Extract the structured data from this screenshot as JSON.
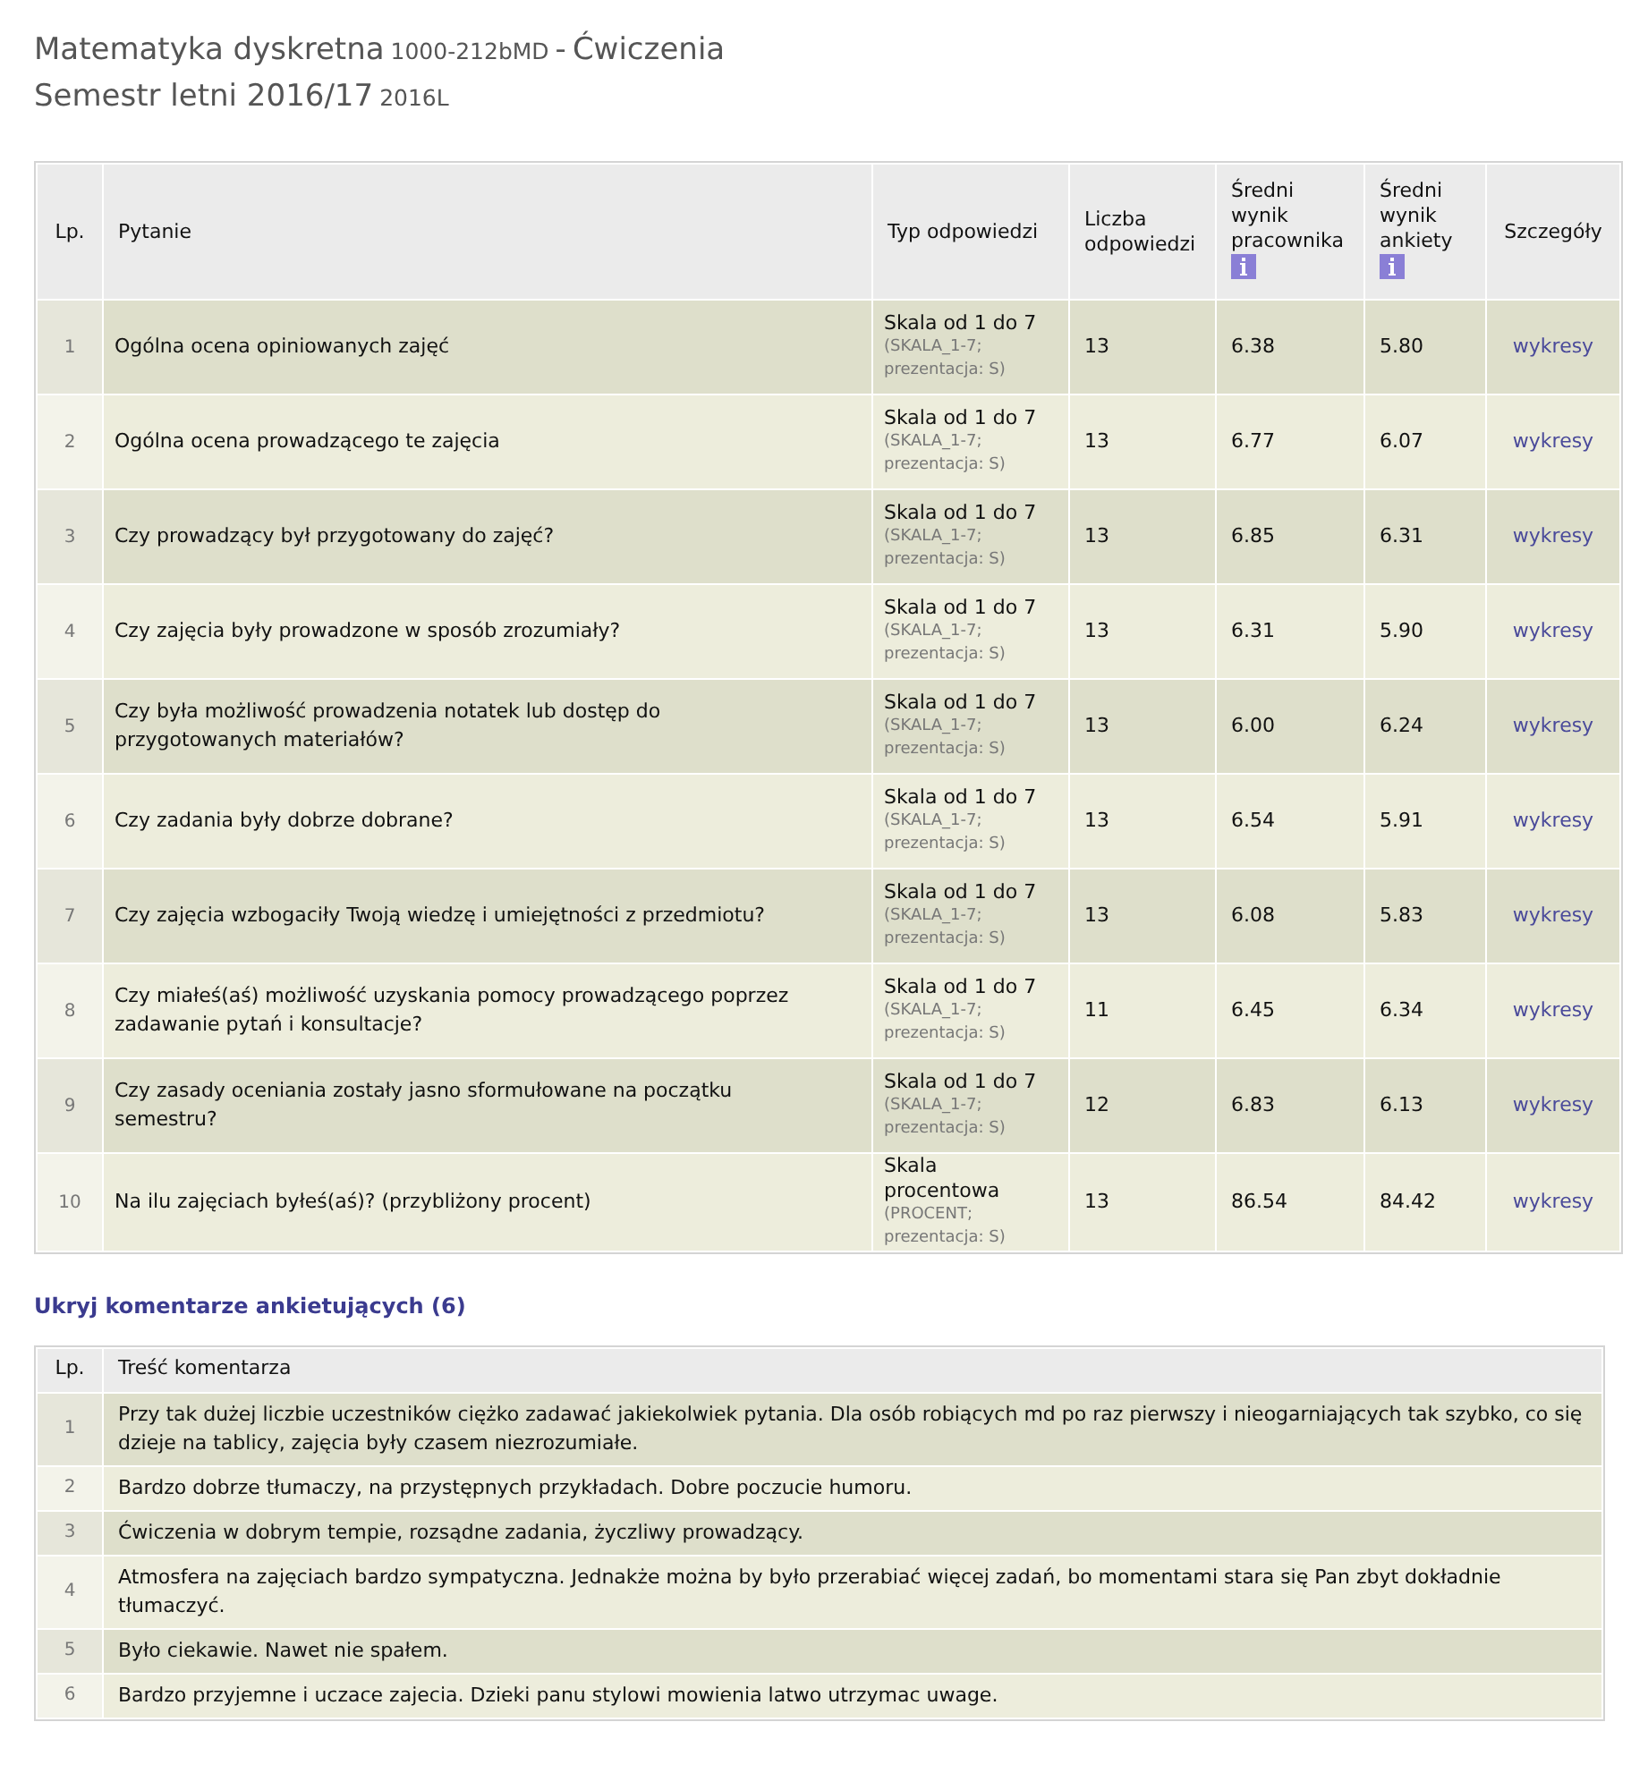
{
  "heading": {
    "course": "Matematyka dyskretna",
    "code": "1000-212bMD",
    "separator": "-",
    "type": "Ćwiczenia",
    "semester": "Semestr letni 2016/17",
    "semester_code": "2016L"
  },
  "questions_table": {
    "columns": [
      {
        "label": "Lp.",
        "info": false
      },
      {
        "label": "Pytanie",
        "info": false
      },
      {
        "label": "Typ odpowiedzi",
        "info": false
      },
      {
        "label": "Liczba odpowiedzi",
        "info": false
      },
      {
        "label": "Średni wynik pracownika",
        "info": true
      },
      {
        "label": "Średni wynik ankiety",
        "info": true
      },
      {
        "label": "Szczegóły",
        "info": false
      }
    ],
    "rows": [
      {
        "lp": "1",
        "question": "Ogólna ocena opiniowanych zajęć",
        "type": "Skala od 1 do 7",
        "type_code": "(SKALA_1-7; prezentacja: S)",
        "count": "13",
        "employee_avg": "6.38",
        "survey_avg": "5.80",
        "link": "wykresy"
      },
      {
        "lp": "2",
        "question": "Ogólna ocena prowadzącego te zajęcia",
        "type": "Skala od 1 do 7",
        "type_code": "(SKALA_1-7; prezentacja: S)",
        "count": "13",
        "employee_avg": "6.77",
        "survey_avg": "6.07",
        "link": "wykresy"
      },
      {
        "lp": "3",
        "question": "Czy prowadzący był przygotowany do zajęć?",
        "type": "Skala od 1 do 7",
        "type_code": "(SKALA_1-7; prezentacja: S)",
        "count": "13",
        "employee_avg": "6.85",
        "survey_avg": "6.31",
        "link": "wykresy"
      },
      {
        "lp": "4",
        "question": "Czy zajęcia były prowadzone w sposób zrozumiały?",
        "type": "Skala od 1 do 7",
        "type_code": "(SKALA_1-7; prezentacja: S)",
        "count": "13",
        "employee_avg": "6.31",
        "survey_avg": "5.90",
        "link": "wykresy"
      },
      {
        "lp": "5",
        "question": "Czy była możliwość prowadzenia notatek lub dostęp do przygotowanych materiałów?",
        "type": "Skala od 1 do 7",
        "type_code": "(SKALA_1-7; prezentacja: S)",
        "count": "13",
        "employee_avg": "6.00",
        "survey_avg": "6.24",
        "link": "wykresy"
      },
      {
        "lp": "6",
        "question": "Czy zadania były dobrze dobrane?",
        "type": "Skala od 1 do 7",
        "type_code": "(SKALA_1-7; prezentacja: S)",
        "count": "13",
        "employee_avg": "6.54",
        "survey_avg": "5.91",
        "link": "wykresy"
      },
      {
        "lp": "7",
        "question": "Czy zajęcia wzbogaciły Twoją wiedzę i umiejętności z przedmiotu?",
        "type": "Skala od 1 do 7",
        "type_code": "(SKALA_1-7; prezentacja: S)",
        "count": "13",
        "employee_avg": "6.08",
        "survey_avg": "5.83",
        "link": "wykresy"
      },
      {
        "lp": "8",
        "question": "Czy miałeś(aś) możliwość uzyskania pomocy prowadzącego poprzez zadawanie pytań i konsultacje?",
        "type": "Skala od 1 do 7",
        "type_code": "(SKALA_1-7; prezentacja: S)",
        "count": "11",
        "employee_avg": "6.45",
        "survey_avg": "6.34",
        "link": "wykresy"
      },
      {
        "lp": "9",
        "question": "Czy zasady oceniania zostały jasno sformułowane na początku semestru?",
        "type": "Skala od 1 do 7",
        "type_code": "(SKALA_1-7; prezentacja: S)",
        "count": "12",
        "employee_avg": "6.83",
        "survey_avg": "6.13",
        "link": "wykresy"
      },
      {
        "lp": "10",
        "question": "Na ilu zajęciach byłeś(aś)? (przybliżony procent)",
        "type": "Skala procentowa",
        "type_code": "(PROCENT; prezentacja: S)",
        "count": "13",
        "employee_avg": "86.54",
        "survey_avg": "84.42",
        "link": "wykresy"
      }
    ]
  },
  "comments_toggle": "Ukryj komentarze ankietujących (6)",
  "comments_table": {
    "columns": [
      "Lp.",
      "Treść komentarza"
    ],
    "rows": [
      {
        "lp": "1",
        "text": "Przy tak dużej liczbie uczestników ciężko zadawać jakiekolwiek pytania. Dla osób robiących md po raz pierwszy i nieogarniających tak szybko, co się dzieje na tablicy, zajęcia były czasem niezrozumiałe."
      },
      {
        "lp": "2",
        "text": "Bardzo dobrze tłumaczy, na przystępnych przykładach. Dobre poczucie humoru."
      },
      {
        "lp": "3",
        "text": "Ćwiczenia w dobrym tempie, rozsądne zadania, życzliwy prowadzący."
      },
      {
        "lp": "4",
        "text": "Atmosfera na zajęciach bardzo sympatyczna. Jednakże można by było przerabiać więcej zadań, bo momentami stara się Pan zbyt dokładnie tłumaczyć."
      },
      {
        "lp": "5",
        "text": "Było ciekawie. Nawet nie spałem."
      },
      {
        "lp": "6",
        "text": "Bardzo przyjemne i uczace zajecia. Dzieki panu stylowi mowienia latwo utrzymac uwage."
      }
    ]
  }
}
